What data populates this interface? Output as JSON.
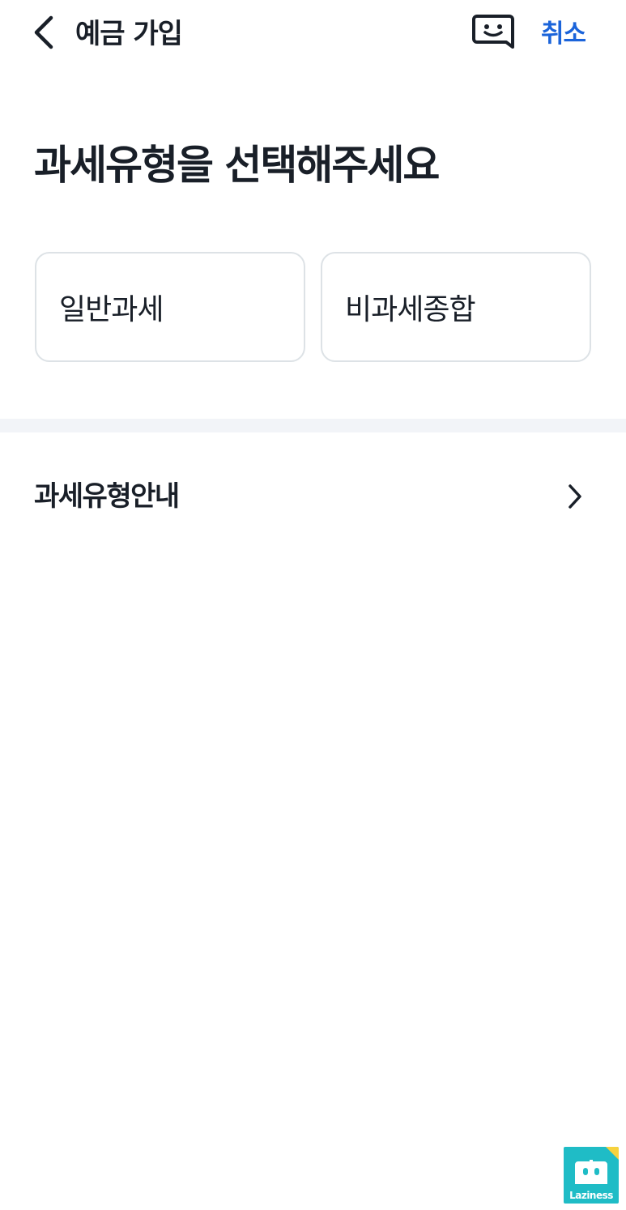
{
  "header": {
    "title": "예금 가입",
    "cancel_label": "취소",
    "back_icon": "chevron-left-icon",
    "chat_icon": "chat-smile-icon"
  },
  "main": {
    "heading": "과세유형을 선택해주세요",
    "options": [
      {
        "label": "일반과세"
      },
      {
        "label": "비과세종합"
      }
    ]
  },
  "info": {
    "label": "과세유형안내",
    "icon": "chevron-right-icon"
  },
  "watermark": {
    "text": "Laziness"
  },
  "colors": {
    "accent": "#1b64da",
    "text": "#191f28",
    "card_border": "#dde2e6",
    "divider": "#f2f4f8",
    "logo_bg": "#1fbcc6",
    "logo_corner": "#f7d23e"
  }
}
